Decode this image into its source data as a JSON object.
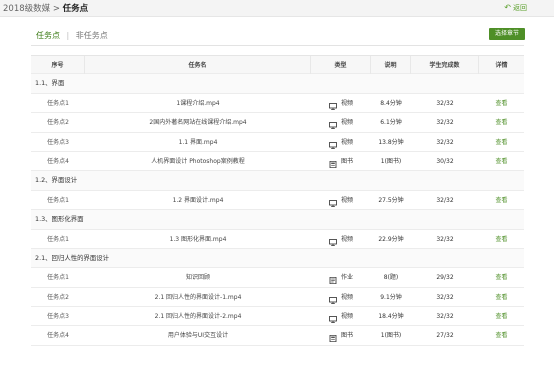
{
  "header": {
    "course": "2018级数媒",
    "separator": ">",
    "current": "任务点",
    "back_label": "返回",
    "back_icon": "↶"
  },
  "tabs": [
    {
      "label": "任务点",
      "active": true
    },
    {
      "label": "非任务点",
      "active": false
    }
  ],
  "tab_separator": "|",
  "select_button": "选择章节",
  "accent_color": "#4e8f27",
  "columns": [
    "序号",
    "任务名",
    "类型",
    "说明",
    "学生完成数",
    "详情"
  ],
  "chapters": [
    {
      "title": "1.1、界面",
      "rows": [
        {
          "id": "任务点1",
          "name": "1课程介绍.mp4",
          "type": "视频",
          "type_icon": "monitor-icon",
          "desc": "8.4分钟",
          "done": "32/32",
          "action": "查看"
        },
        {
          "id": "任务点2",
          "name": "2国内外著名网站在线课程介绍.mp4",
          "type": "视频",
          "type_icon": "monitor-icon",
          "desc": "6.1分钟",
          "done": "32/32",
          "action": "查看"
        },
        {
          "id": "任务点3",
          "name": "1.1 界面.mp4",
          "type": "视频",
          "type_icon": "monitor-icon",
          "desc": "13.8分钟",
          "done": "32/32",
          "action": "查看"
        },
        {
          "id": "任务点4",
          "name": "人机界面设计 Photoshop案例教程",
          "type": "图书",
          "type_icon": "book-icon",
          "desc": "1(图书)",
          "done": "30/32",
          "action": "查看"
        }
      ]
    },
    {
      "title": "1.2、界面设计",
      "rows": [
        {
          "id": "任务点1",
          "name": "1.2 界面设计.mp4",
          "type": "视频",
          "type_icon": "monitor-icon",
          "desc": "27.5分钟",
          "done": "32/32",
          "action": "查看"
        }
      ]
    },
    {
      "title": "1.3、图形化界面",
      "rows": [
        {
          "id": "任务点1",
          "name": "1.3 图形化界面.mp4",
          "type": "视频",
          "type_icon": "monitor-icon",
          "desc": "22.9分钟",
          "done": "32/32",
          "action": "查看"
        }
      ]
    },
    {
      "title": "2.1、回归人性的界面设计",
      "rows": [
        {
          "id": "任务点1",
          "name": "知识回顾",
          "type": "作业",
          "type_icon": "assignment-icon",
          "desc": "8(题)",
          "done": "29/32",
          "action": "查看"
        },
        {
          "id": "任务点2",
          "name": "2.1 回归人性的界面设计-1.mp4",
          "type": "视频",
          "type_icon": "monitor-icon",
          "desc": "9.1分钟",
          "done": "32/32",
          "action": "查看"
        },
        {
          "id": "任务点3",
          "name": "2.1 回归人性的界面设计-2.mp4",
          "type": "视频",
          "type_icon": "monitor-icon",
          "desc": "18.4分钟",
          "done": "32/32",
          "action": "查看"
        },
        {
          "id": "任务点4",
          "name": "用户体验与UI交互设计",
          "type": "图书",
          "type_icon": "book-icon",
          "desc": "1(图书)",
          "done": "27/32",
          "action": "查看"
        }
      ]
    }
  ]
}
